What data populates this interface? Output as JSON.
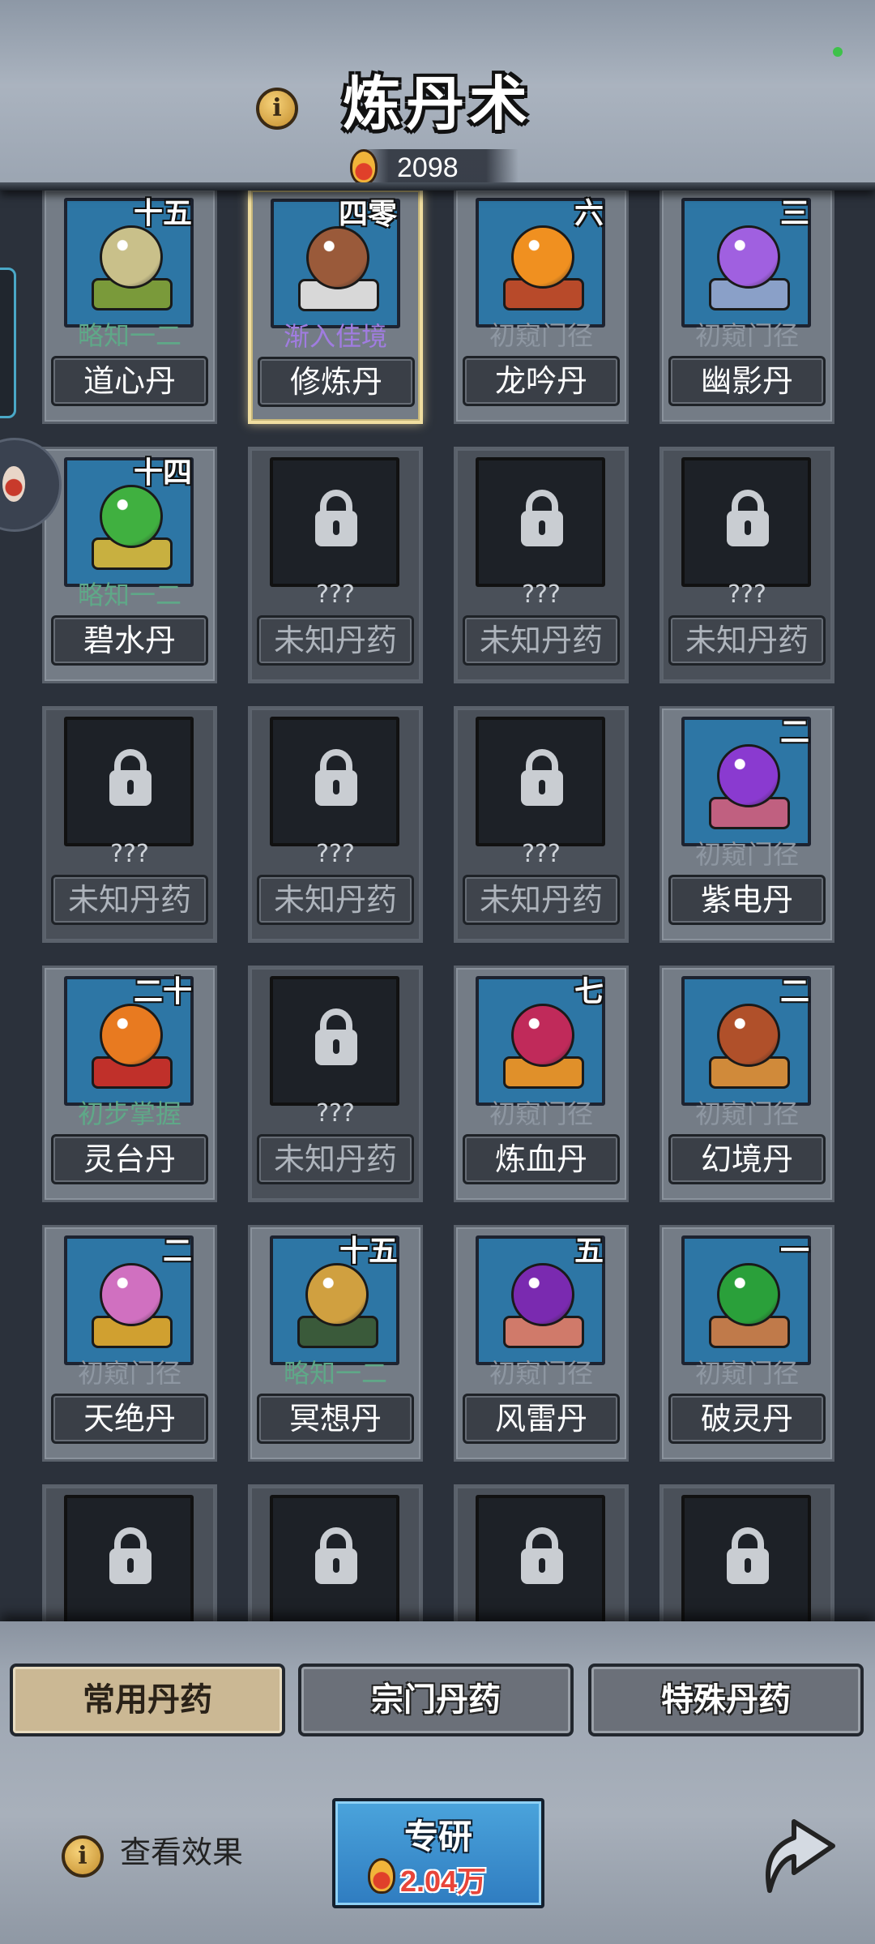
{
  "header": {
    "title": "炼丹术",
    "currency_value": "2098"
  },
  "grid": {
    "cards": [
      {
        "name": "道心丹",
        "rank": "略知一二",
        "level": "十五",
        "rank_color": "green",
        "art": "leaf",
        "locked": false,
        "selected": false
      },
      {
        "name": "修炼丹",
        "rank": "渐入佳境",
        "level": "四零",
        "rank_color": "purple",
        "art": "bowl",
        "locked": false,
        "selected": true
      },
      {
        "name": "龙吟丹",
        "rank": "初窥门径",
        "level": "六",
        "rank_color": "grey",
        "art": "flower-orange",
        "locked": false,
        "selected": false
      },
      {
        "name": "幽影丹",
        "rank": "初窥门径",
        "level": "三",
        "rank_color": "grey",
        "art": "crystal-purple",
        "locked": false,
        "selected": false
      },
      {
        "name": "碧水丹",
        "rank": "略知一二",
        "level": "十四",
        "rank_color": "green",
        "art": "leaf-green",
        "locked": false,
        "selected": false
      },
      {
        "name": "未知丹药",
        "rank": "???",
        "level": "",
        "locked": true
      },
      {
        "name": "未知丹药",
        "rank": "???",
        "level": "",
        "locked": true
      },
      {
        "name": "未知丹药",
        "rank": "???",
        "level": "",
        "locked": true
      },
      {
        "name": "未知丹药",
        "rank": "???",
        "level": "",
        "locked": true
      },
      {
        "name": "未知丹药",
        "rank": "???",
        "level": "",
        "locked": true
      },
      {
        "name": "未知丹药",
        "rank": "???",
        "level": "",
        "locked": true
      },
      {
        "name": "紫电丹",
        "rank": "初窥门径",
        "level": "二",
        "rank_color": "grey",
        "art": "orb-purple",
        "locked": false,
        "selected": false
      },
      {
        "name": "灵台丹",
        "rank": "初步掌握",
        "level": "二十",
        "rank_color": "green",
        "art": "orb-flame",
        "locked": false,
        "selected": false
      },
      {
        "name": "未知丹药",
        "rank": "???",
        "level": "",
        "locked": true
      },
      {
        "name": "炼血丹",
        "rank": "初窥门径",
        "level": "七",
        "rank_color": "grey",
        "art": "orb-crimson",
        "locked": false,
        "selected": false
      },
      {
        "name": "幻境丹",
        "rank": "初窥门径",
        "level": "二",
        "rank_color": "grey",
        "art": "orb-brown",
        "locked": false,
        "selected": false
      },
      {
        "name": "天绝丹",
        "rank": "初窥门径",
        "level": "二",
        "rank_color": "grey",
        "art": "orb-pink",
        "locked": false,
        "selected": false
      },
      {
        "name": "冥想丹",
        "rank": "略知一二",
        "level": "十五",
        "rank_color": "green",
        "art": "orb-gold",
        "locked": false,
        "selected": false
      },
      {
        "name": "风雷丹",
        "rank": "初窥门径",
        "level": "五",
        "rank_color": "grey",
        "art": "orb-violet",
        "locked": false,
        "selected": false
      },
      {
        "name": "破灵丹",
        "rank": "初窥门径",
        "level": "一",
        "rank_color": "grey",
        "art": "orb-green",
        "locked": false,
        "selected": false
      },
      {
        "name": "",
        "rank": "???",
        "level": "",
        "locked": true
      },
      {
        "name": "",
        "rank": "???",
        "level": "",
        "locked": true
      },
      {
        "name": "",
        "rank": "???",
        "level": "",
        "locked": true
      },
      {
        "name": "",
        "rank": "???",
        "level": "",
        "locked": true
      }
    ]
  },
  "tabs": [
    {
      "label": "常用丹药",
      "active": true
    },
    {
      "label": "宗门丹药",
      "active": false
    },
    {
      "label": "特殊丹药",
      "active": false
    }
  ],
  "footer": {
    "view_effect_label": "查看效果",
    "research_label": "专研",
    "research_cost": "2.04万"
  },
  "colors": {
    "rank_green": "#5fa888",
    "rank_purple": "#a07ce0",
    "rank_grey": "#8e97a2",
    "icon_bg": "#2d76a5",
    "selected_border": "#f0dea0",
    "active_tab": "#cbb894"
  }
}
